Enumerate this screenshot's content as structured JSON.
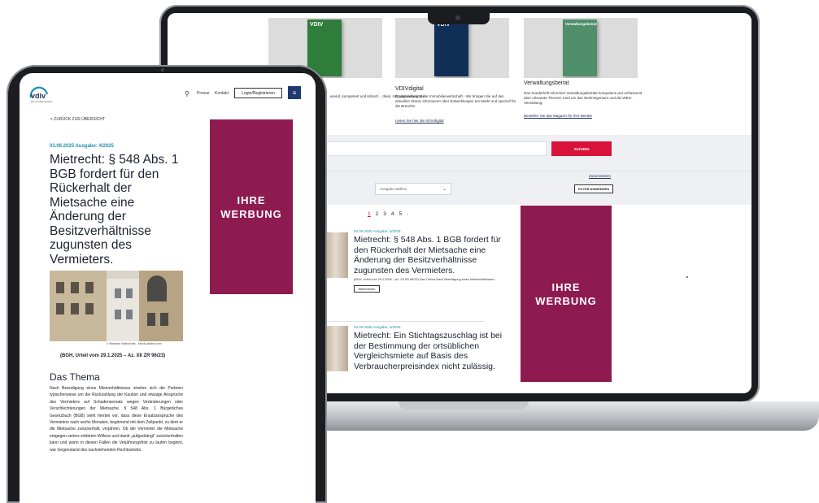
{
  "laptop": {
    "magazines": [
      {
        "cover_label": "VDIV",
        "title": "",
        "desc": "...esend, kompetent und kritisch ...rtikel, Hintergrundberichte",
        "link": "",
        "cover_color": "#2e7d3a"
      },
      {
        "cover_label": "VDIV",
        "title": "VDIVdigital",
        "desc": "Digitalisierung in der Immobilienwirtschaft - Wir bringen Sie auf den aktuellen Stand, informieren über Entwicklungen am Markt und speziell für die Branche.",
        "link": "Lesen Sie hier die VDIVdigital",
        "cover_color": "#0f2f57"
      },
      {
        "cover_label": "Verwaltungsbeirat",
        "title": "Verwaltungsbeirat",
        "desc": "Das Sonderheft informiert Verwaltungsbeiräte kompetent und umfassend über relevante Themen rund um das Wohneigentum und die WEG-Verwaltung.",
        "link": "Bestellen Sie das Magazin für Ihre Beiräte",
        "cover_color": "#4f8f6a"
      }
    ],
    "search_button": "SUCHEN",
    "reset_link": "Zurücksetzen",
    "select_issue": "Ausgabe wählen",
    "filter_button": "FILTER ANWENDEN",
    "pagination": [
      "1",
      "2",
      "3",
      "4",
      "5",
      "›"
    ],
    "articles": [
      {
        "meta": "03.06.2025   Ausgabe: 4/2025",
        "title": "Mietrecht: § 548 Abs. 1 BGB fordert für den Rückerhalt der Mietsache eine Änderung der Besitzverhältnisse zugunsten des Vermieters.",
        "small": "(BGH, Urteil vom 29.1.2025 – Az. XII ZR 96/23) Das Thema Nach Beendigung eines Mietverhältnisses...",
        "button": "Weiterlesen"
      },
      {
        "meta": "03.06.2025   Ausgabe: 4/2025",
        "title": "Mietrecht: Ein Stichtagszuschlag ist bei der Bestimmung der ortsüblichen Vergleichsmiete auf Basis des Verbraucherpreisindex nicht zulässig."
      }
    ],
    "ad": {
      "line1": "IHRE",
      "line2": "WERBUNG"
    }
  },
  "tablet": {
    "logo": "vdiv",
    "logo_sub": "Die Immobilienverwalter",
    "nav": {
      "presse": "Presse",
      "kontakt": "Kontakt",
      "login": "Login/Registrieren",
      "menu": "MENÜ"
    },
    "back_link": "< ZURÜCK ZUR ÜBERSICHT",
    "meta": "03.06.2025 Ausgabe: 4/2025",
    "title": "Mietrecht: § 548 Abs. 1 BGB fordert für den Rückerhalt der Mietsache eine Änderung der Besitzverhältnisse zugunsten des Vermieters.",
    "photo_credit": "c Stephan Walochnik - stock.adobe.com",
    "ruling": "(BGH, Urteil vom 29.1.2025 – Az. XII ZR 96/23)",
    "section_heading": "Das Thema",
    "body": "Nach Beendigung eines Mietverhältnisses streiten sich die Parteien typischerweise um die Rückzahlung der Kaution und etwaige Ansprüche des Vermieters auf Schadensersatz wegen Veränderungen oder Verschlechterungen der Mietsache. § 548 Abs. 1 Bürgerliches Gesetzbuch (BGB) sieht hierbei vor, dass diese Ersatzansprüche des Vermieters nach sechs Monaten, beginnend mit dem Zeitpunkt, zu dem er die Mietsache zurückerhält, verjähren. Ob der Vermieter die Mietsache entgegen seines erklärten Willens und damit „aufgedrängt“ zurückerhalten kann und wann in diesen Fällen die Verjährungsfrist zu laufen beginnt, war Gegenstand des nachstehenden Rechtsstreits:",
    "ad": {
      "line1": "IHRE",
      "line2": "WERBUNG"
    }
  },
  "colors": {
    "accent_red": "#d8123a",
    "ad_bg": "#8e1b4f",
    "teal": "#1f8fae",
    "navy": "#1e2a55"
  }
}
